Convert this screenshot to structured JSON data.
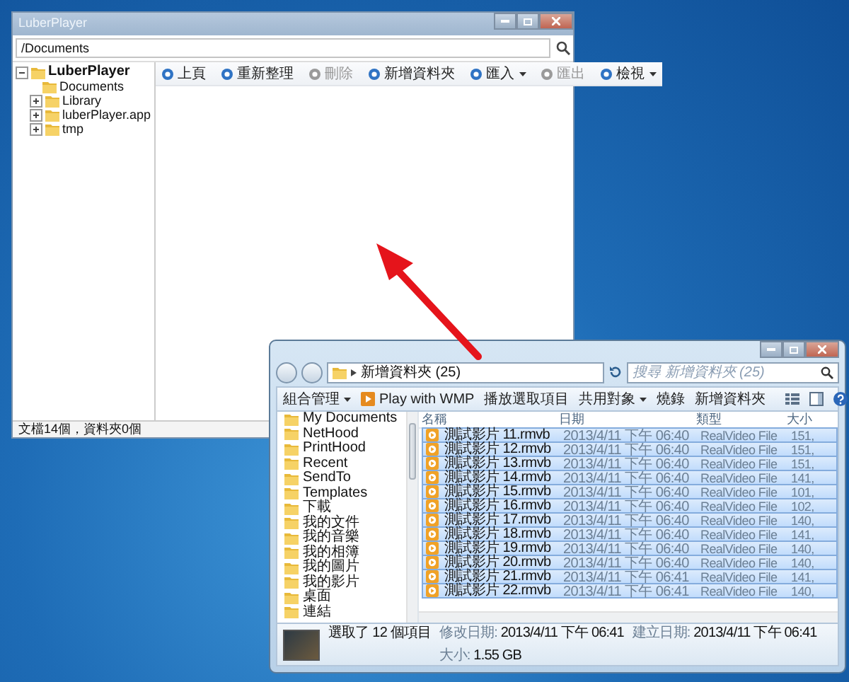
{
  "player": {
    "title": "LuberPlayer",
    "path": "/Documents",
    "tree": [
      {
        "label": "LuberPlayer",
        "expanded": true,
        "children": [
          {
            "label": "Documents",
            "expandable": false
          },
          {
            "label": "Library",
            "expandable": true
          },
          {
            "label": "luberPlayer.app",
            "expandable": true
          },
          {
            "label": "tmp",
            "expandable": true
          }
        ]
      }
    ],
    "toolbar": [
      {
        "label": "上頁",
        "disabled": false,
        "dropdown": false
      },
      {
        "label": "重新整理",
        "disabled": false,
        "dropdown": false
      },
      {
        "label": "刪除",
        "disabled": true,
        "dropdown": false
      },
      {
        "label": "新增資料夾",
        "disabled": false,
        "dropdown": false
      },
      {
        "label": "匯入",
        "disabled": false,
        "dropdown": true
      },
      {
        "label": "匯出",
        "disabled": true,
        "dropdown": false
      },
      {
        "label": "檢視",
        "disabled": false,
        "dropdown": true
      }
    ],
    "status": "文檔14個，資料夾0個"
  },
  "explorer": {
    "breadcrumb": "新增資料夾 (25)",
    "search_placeholder": "搜尋 新增資料夾 (25)",
    "toolbar": [
      {
        "label": "組合管理",
        "dropdown": true,
        "kind": "text"
      },
      {
        "label": "Play with WMP",
        "dropdown": false,
        "kind": "player"
      },
      {
        "label": "播放選取項目",
        "dropdown": false,
        "kind": "text"
      },
      {
        "label": "共用對象",
        "dropdown": true,
        "kind": "text"
      },
      {
        "label": "燒錄",
        "dropdown": false,
        "kind": "text"
      },
      {
        "label": "新增資料夾",
        "dropdown": false,
        "kind": "text"
      }
    ],
    "nav": [
      "My Documents",
      "NetHood",
      "PrintHood",
      "Recent",
      "SendTo",
      "Templates",
      "下載",
      "我的文件",
      "我的音樂",
      "我的相簿",
      "我的圖片",
      "我的影片",
      "桌面",
      "連結"
    ],
    "columns": [
      "名稱",
      "日期",
      "類型",
      "大小"
    ],
    "rows": [
      {
        "name": "測試影片 11.rmvb",
        "date": "2013/4/11 下午 06:40",
        "type": "RealVideo File",
        "size": "151,",
        "selected": true
      },
      {
        "name": "測試影片 12.rmvb",
        "date": "2013/4/11 下午 06:40",
        "type": "RealVideo File",
        "size": "151,",
        "selected": true
      },
      {
        "name": "測試影片 13.rmvb",
        "date": "2013/4/11 下午 06:40",
        "type": "RealVideo File",
        "size": "151,",
        "selected": true
      },
      {
        "name": "測試影片 14.rmvb",
        "date": "2013/4/11 下午 06:40",
        "type": "RealVideo File",
        "size": "141,",
        "selected": true
      },
      {
        "name": "測試影片 15.rmvb",
        "date": "2013/4/11 下午 06:40",
        "type": "RealVideo File",
        "size": "101,",
        "selected": true
      },
      {
        "name": "測試影片 16.rmvb",
        "date": "2013/4/11 下午 06:40",
        "type": "RealVideo File",
        "size": "102,",
        "selected": true
      },
      {
        "name": "測試影片 17.rmvb",
        "date": "2013/4/11 下午 06:40",
        "type": "RealVideo File",
        "size": "140,",
        "selected": true
      },
      {
        "name": "測試影片 18.rmvb",
        "date": "2013/4/11 下午 06:40",
        "type": "RealVideo File",
        "size": "141,",
        "selected": true
      },
      {
        "name": "測試影片 19.rmvb",
        "date": "2013/4/11 下午 06:40",
        "type": "RealVideo File",
        "size": "140,",
        "selected": true
      },
      {
        "name": "測試影片 20.rmvb",
        "date": "2013/4/11 下午 06:40",
        "type": "RealVideo File",
        "size": "140,",
        "selected": true
      },
      {
        "name": "測試影片 21.rmvb",
        "date": "2013/4/11 下午 06:41",
        "type": "RealVideo File",
        "size": "141,",
        "selected": true
      },
      {
        "name": "測試影片 22.rmvb",
        "date": "2013/4/11 下午 06:41",
        "type": "RealVideo File",
        "size": "140,",
        "selected": true
      }
    ],
    "details": {
      "summary": "選取了 12 個項目",
      "fields": [
        {
          "label": "修改日期:",
          "value": "2013/4/11 下午 06:41"
        },
        {
          "label": "建立日期:",
          "value": "2013/4/11 下午 06:41"
        },
        {
          "label": "大小:",
          "value": "1.55 GB"
        }
      ]
    }
  }
}
